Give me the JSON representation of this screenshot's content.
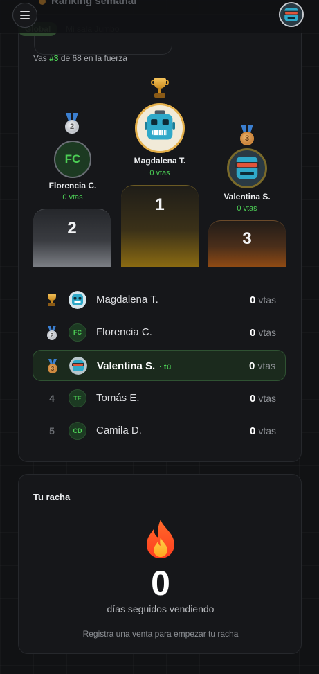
{
  "header": {
    "title": "Ranking semanal",
    "menu_icon": "hamburger-menu-icon",
    "avatar_icon": "robot-avatar"
  },
  "tabs": [
    {
      "label": "Global",
      "active": true
    },
    {
      "label": "Mi sala Jumbo",
      "active": false
    }
  ],
  "summary": {
    "prefix": "Vas ",
    "rank": "#3",
    "suffix": " de 68 en la fuerza"
  },
  "podium": {
    "first": {
      "name": "Magdalena T.",
      "sales": "0 vtas",
      "place": "1",
      "avatar": "robot-avatar"
    },
    "second": {
      "name": "Florencia C.",
      "sales": "0 vtas",
      "place": "2",
      "initials": "FC"
    },
    "third": {
      "name": "Valentina S.",
      "sales": "0 vtas",
      "place": "3",
      "avatar": "robot-avatar-visor"
    }
  },
  "ranking": [
    {
      "pos": "1",
      "name": "Magdalena T.",
      "count": "0",
      "unit": "vtas",
      "avatar": "robot-avatar"
    },
    {
      "pos": "2",
      "name": "Florencia C.",
      "count": "0",
      "unit": "vtas",
      "initials": "FC"
    },
    {
      "pos": "3",
      "name": "Valentina S.",
      "you": "· tú",
      "count": "0",
      "unit": "vtas",
      "avatar": "robot-avatar-visor"
    },
    {
      "pos": "4",
      "name": "Tomás E.",
      "count": "0",
      "unit": "vtas",
      "initials": "TE"
    },
    {
      "pos": "5",
      "name": "Camila D.",
      "count": "0",
      "unit": "vtas",
      "initials": "CD"
    }
  ],
  "streak": {
    "title": "Tu racha",
    "value": "0",
    "label": "días seguidos vendiendo",
    "hint": "Registra una venta para empezar tu racha"
  },
  "colors": {
    "accent_green": "#4ccf55",
    "background": "#111214",
    "card": "#16171a",
    "gold": "#f4c35b",
    "bronze": "#d18a3f"
  }
}
